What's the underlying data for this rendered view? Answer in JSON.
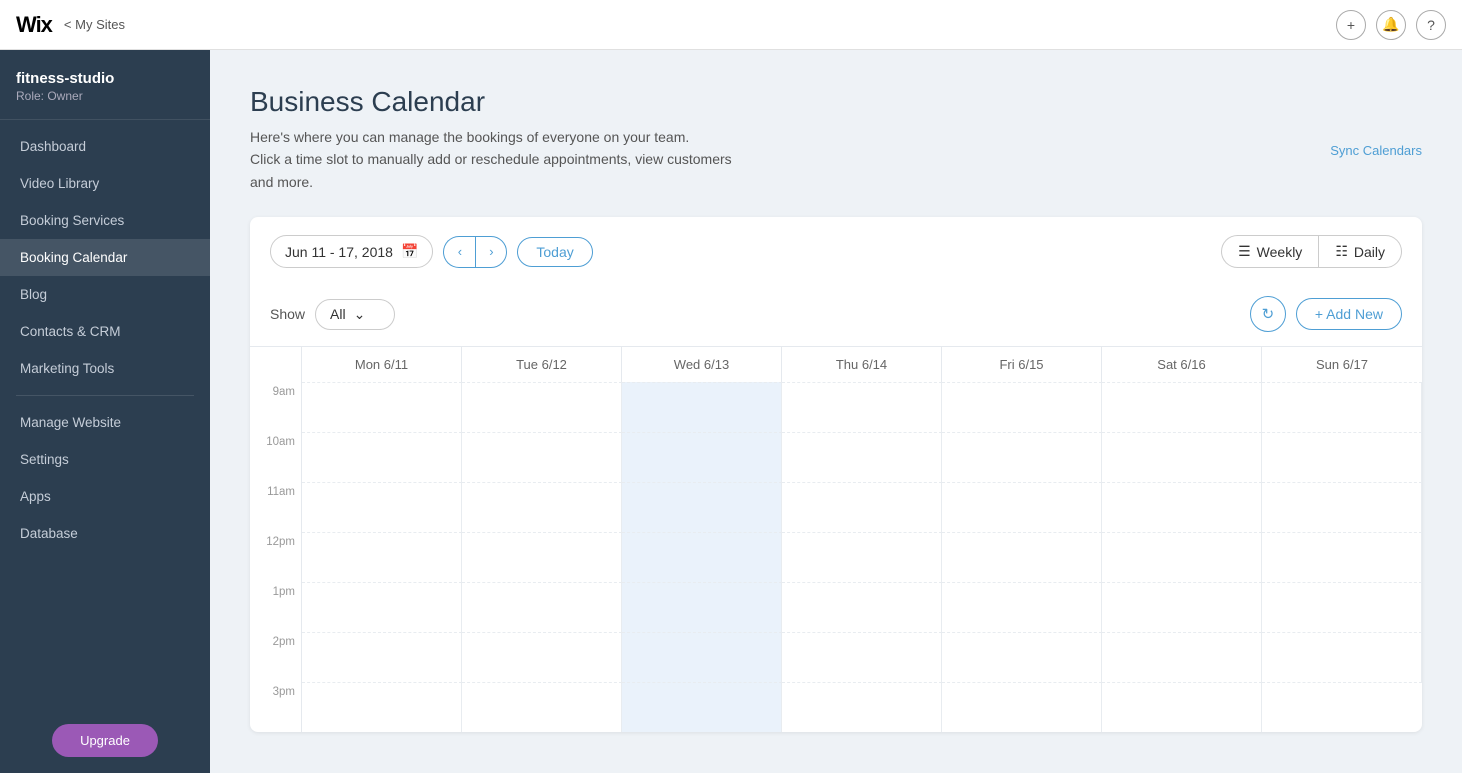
{
  "topbar": {
    "logo": "Wix",
    "back_label": "< My Sites",
    "add_icon": "+",
    "bell_icon": "🔔",
    "help_icon": "?"
  },
  "sidebar": {
    "site_name": "fitness-studio",
    "site_role": "Role: Owner",
    "nav_items": [
      {
        "label": "Dashboard",
        "active": false
      },
      {
        "label": "Video Library",
        "active": false
      },
      {
        "label": "Booking Services",
        "active": false
      },
      {
        "label": "Booking Calendar",
        "active": true
      },
      {
        "label": "Blog",
        "active": false
      },
      {
        "label": "Contacts & CRM",
        "active": false
      },
      {
        "label": "Marketing Tools",
        "active": false
      },
      {
        "label": "Manage Website",
        "active": false
      },
      {
        "label": "Settings",
        "active": false
      },
      {
        "label": "Apps",
        "active": false
      },
      {
        "label": "Database",
        "active": false
      }
    ],
    "upgrade_label": "Upgrade"
  },
  "main": {
    "page_title": "Business Calendar",
    "page_desc_line1": "Here's where you can manage the bookings of everyone on your team.",
    "page_desc_line2": "Click a time slot to manually add or reschedule appointments, view customers",
    "page_desc_line3": "and more.",
    "sync_label": "Sync Calendars",
    "date_range": "Jun 11 - 17, 2018",
    "today_label": "Today",
    "weekly_label": "Weekly",
    "daily_label": "Daily",
    "show_label": "Show",
    "show_value": "All",
    "add_new_label": "+ Add New",
    "calendar_days": [
      {
        "label": "Mon 6/11",
        "highlighted": false
      },
      {
        "label": "Tue 6/12",
        "highlighted": false
      },
      {
        "label": "Wed 6/13",
        "highlighted": true
      },
      {
        "label": "Thu 6/14",
        "highlighted": false
      },
      {
        "label": "Fri 6/15",
        "highlighted": false
      },
      {
        "label": "Sat 6/16",
        "highlighted": false
      },
      {
        "label": "Sun 6/17",
        "highlighted": false
      }
    ],
    "time_slots": [
      "9am",
      "10am",
      "11am",
      "12pm",
      "1pm",
      "2pm",
      "3pm"
    ]
  }
}
